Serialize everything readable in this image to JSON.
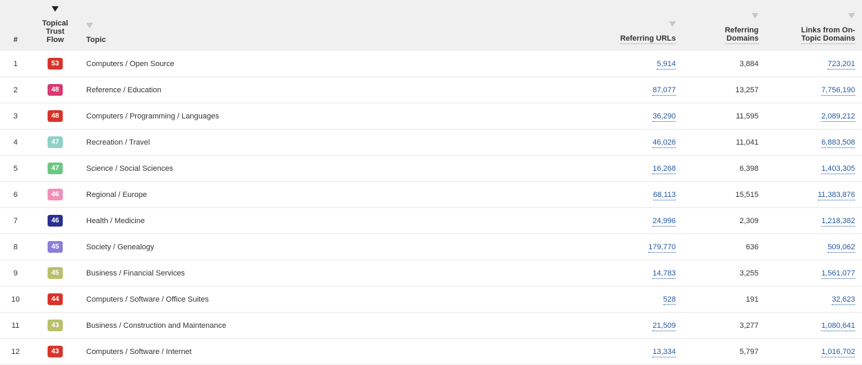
{
  "headers": {
    "idx": "#",
    "ttf": "Topical\nTrust Flow",
    "topic": "Topic",
    "refu": "Referring URLs",
    "refd": "Referring\nDomains",
    "links": "Links from On-\nTopic Domains"
  },
  "rows": [
    {
      "n": "1",
      "ttf": "53",
      "ttf_color": "#d9332b",
      "topic": "Computers / Open Source",
      "refu": "5,914",
      "refd": "3,884",
      "links": "723,201"
    },
    {
      "n": "2",
      "ttf": "48",
      "ttf_color": "#d83a72",
      "topic": "Reference / Education",
      "refu": "87,077",
      "refd": "13,257",
      "links": "7,756,190"
    },
    {
      "n": "3",
      "ttf": "48",
      "ttf_color": "#d9332b",
      "topic": "Computers / Programming / Languages",
      "refu": "36,290",
      "refd": "11,595",
      "links": "2,089,212"
    },
    {
      "n": "4",
      "ttf": "47",
      "ttf_color": "#8fd1c9",
      "topic": "Recreation / Travel",
      "refu": "46,026",
      "refd": "11,041",
      "links": "6,883,508"
    },
    {
      "n": "5",
      "ttf": "47",
      "ttf_color": "#6cc784",
      "topic": "Science / Social Sciences",
      "refu": "16,268",
      "refd": "6,398",
      "links": "1,403,305"
    },
    {
      "n": "6",
      "ttf": "46",
      "ttf_color": "#f18fb9",
      "topic": "Regional / Europe",
      "refu": "68,113",
      "refd": "15,515",
      "links": "11,383,876"
    },
    {
      "n": "7",
      "ttf": "46",
      "ttf_color": "#2b2f8f",
      "topic": "Health / Medicine",
      "refu": "24,996",
      "refd": "2,309",
      "links": "1,218,382"
    },
    {
      "n": "8",
      "ttf": "45",
      "ttf_color": "#8a7fd6",
      "topic": "Society / Genealogy",
      "refu": "179,770",
      "refd": "636",
      "links": "509,062"
    },
    {
      "n": "9",
      "ttf": "45",
      "ttf_color": "#b9bf6b",
      "topic": "Business / Financial Services",
      "refu": "14,783",
      "refd": "3,255",
      "links": "1,561,077"
    },
    {
      "n": "10",
      "ttf": "44",
      "ttf_color": "#d9332b",
      "topic": "Computers / Software / Office Suites",
      "refu": "528",
      "refd": "191",
      "links": "32,623"
    },
    {
      "n": "11",
      "ttf": "43",
      "ttf_color": "#b9bf6b",
      "topic": "Business / Construction and Maintenance",
      "refu": "21,509",
      "refd": "3,277",
      "links": "1,080,641"
    },
    {
      "n": "12",
      "ttf": "43",
      "ttf_color": "#d9332b",
      "topic": "Computers / Software / Internet",
      "refu": "13,334",
      "refd": "5,797",
      "links": "1,016,702"
    }
  ]
}
